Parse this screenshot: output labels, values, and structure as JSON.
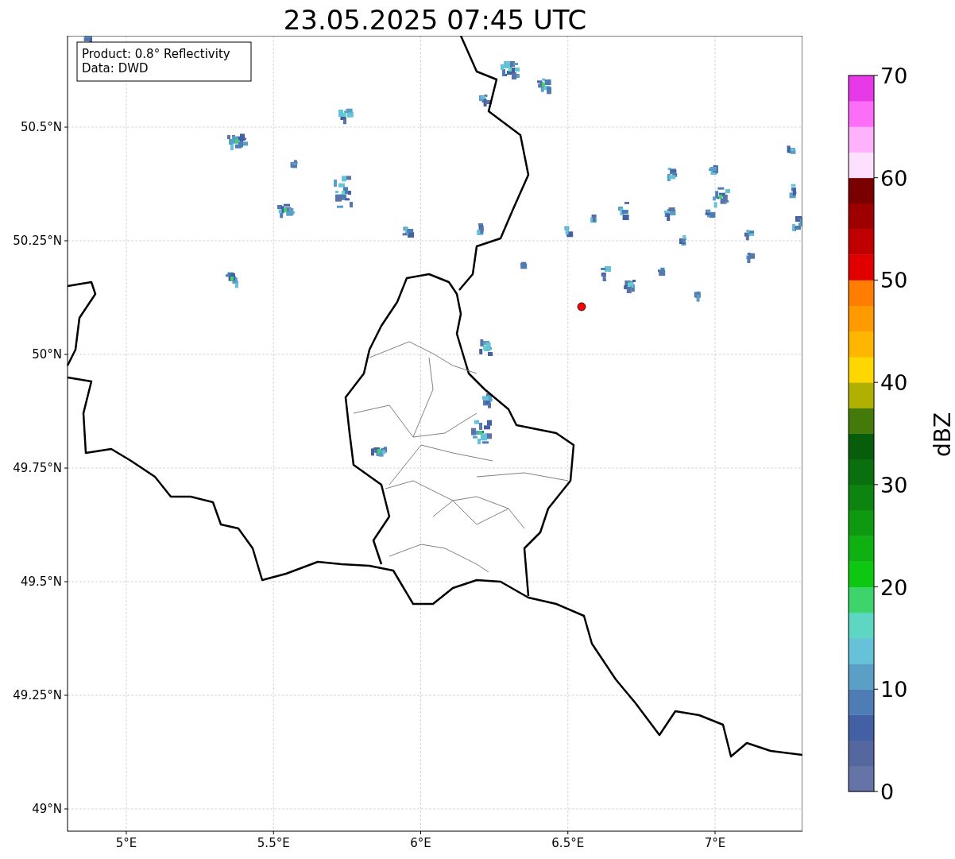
{
  "title": "23.05.2025 07:45 UTC",
  "annotation": [
    "Product: 0.8° Reflectivity",
    "Data: DWD"
  ],
  "map": {
    "lon_labels": [
      "5°E",
      "5.5°E",
      "6°E",
      "6.5°E",
      "7°E"
    ],
    "lat_labels": [
      "50.5°N",
      "50.25°N",
      "50°N",
      "49.75°N",
      "49.5°N",
      "49.25°N",
      "49°N"
    ]
  },
  "colorbar": {
    "label": "dBZ",
    "tick_labels": [
      "70",
      "60",
      "50",
      "40",
      "30",
      "20",
      "10",
      "0"
    ],
    "segments": [
      {
        "color": "#6573a6"
      },
      {
        "color": "#54689f"
      },
      {
        "color": "#4260a3"
      },
      {
        "color": "#4d7db4"
      },
      {
        "color": "#5aa0c6"
      },
      {
        "color": "#65c2d9"
      },
      {
        "color": "#5ed7c2"
      },
      {
        "color": "#3cd46b"
      },
      {
        "color": "#0dc711"
      },
      {
        "color": "#0fb012"
      },
      {
        "color": "#0d9a10"
      },
      {
        "color": "#0c840f"
      },
      {
        "color": "#0a700f"
      },
      {
        "color": "#075d0b"
      },
      {
        "color": "#437a0a"
      },
      {
        "color": "#b0b000"
      },
      {
        "color": "#ffd700"
      },
      {
        "color": "#ffb600"
      },
      {
        "color": "#ff9a00"
      },
      {
        "color": "#ff7d00"
      },
      {
        "color": "#e00000"
      },
      {
        "color": "#c00000"
      },
      {
        "color": "#9e0000"
      },
      {
        "color": "#7a0000"
      },
      {
        "color": "#fde0fd"
      },
      {
        "color": "#feb2fc"
      },
      {
        "color": "#fd6ef8"
      },
      {
        "color": "#e839e8"
      }
    ]
  }
}
